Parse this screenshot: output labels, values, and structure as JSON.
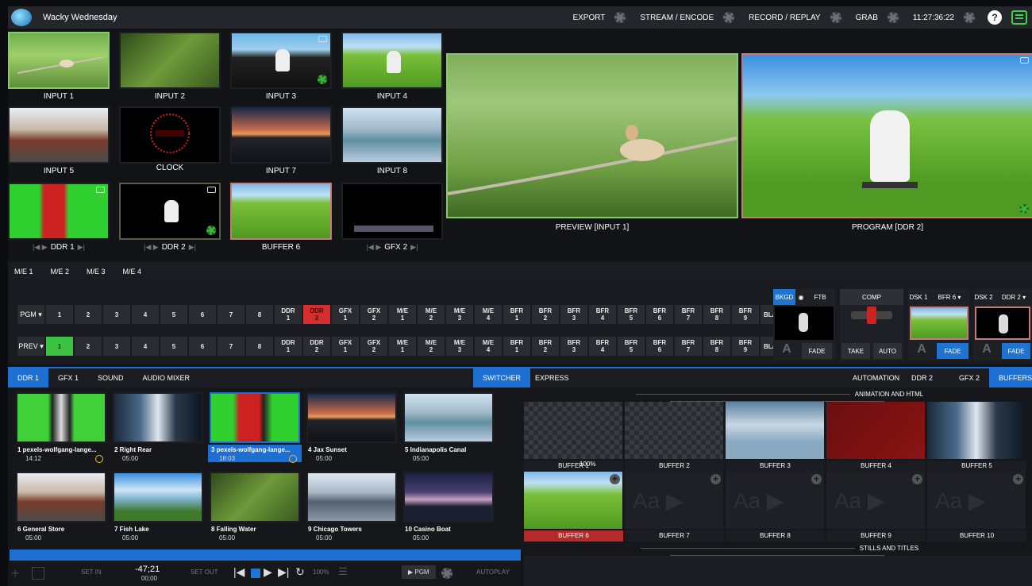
{
  "app": {
    "title": "Wacky Wednesday"
  },
  "topnav": {
    "export": "EXPORT",
    "stream": "STREAM / ENCODE",
    "record": "RECORD / REPLAY",
    "grab": "GRAB",
    "clock": "11:27:36:22",
    "help": "?"
  },
  "inputs": [
    {
      "label": "INPUT 1"
    },
    {
      "label": "INPUT 2"
    },
    {
      "label": "INPUT 3"
    },
    {
      "label": "INPUT 4"
    },
    {
      "label": "INPUT 5"
    },
    {
      "label": "CLOCK"
    },
    {
      "label": "INPUT 7"
    },
    {
      "label": "INPUT 8"
    },
    {
      "label": "DDR 1"
    },
    {
      "label": "DDR 2"
    },
    {
      "label": "BUFFER 6"
    },
    {
      "label": "GFX 2"
    }
  ],
  "monitors": {
    "preview": "PREVIEW [INPUT 1]",
    "program": "PROGRAM [DDR 2]"
  },
  "me_tabs": [
    "M/E 1",
    "M/E 2",
    "M/E 3",
    "M/E 4"
  ],
  "switcher": {
    "pgm_label": "PGM ▾",
    "prev_label": "PREV ▾",
    "buttons": [
      "1",
      "2",
      "3",
      "4",
      "5",
      "6",
      "7",
      "8",
      "DDR 1",
      "DDR 2",
      "GFX 1",
      "GFX 2",
      "M/E 1",
      "M/E 2",
      "M/E 3",
      "M/E 4",
      "BFR 1",
      "BFR 2",
      "BFR 3",
      "BFR 4",
      "BFR 5",
      "BFR 6",
      "BFR 7",
      "BFR 8",
      "BFR 9",
      "BLACK"
    ],
    "pgm_active": "DDR 2",
    "prev_active": "1",
    "colors": {
      "program": "#d42e2e",
      "preview": "#3cc243",
      "accent": "#1d74d1"
    }
  },
  "transition": {
    "bkgd": "BKGD",
    "ftb": "FTB",
    "fade": "Fade",
    "comp": "COMP",
    "take": "TAKE",
    "auto": "AUTO",
    "dsk1": "DSK 1",
    "dsk1_src": "BFR 6 ▾",
    "dsk1_fade": "Fade",
    "dsk2": "DSK 2",
    "dsk2_src": "DDR 2 ▾",
    "dsk2_fade": "Fade",
    "tbar_letter": "A"
  },
  "lower_tabs_left": [
    "DDR 1",
    "GFX 1",
    "SOUND",
    "AUDIO MIXER"
  ],
  "switcher_tab": "SWITCHER",
  "lower_tabs_right": [
    "EXPRESS",
    "AUTOMATION",
    "DDR 2",
    "GFX 2",
    "BUFFERS"
  ],
  "clips": [
    {
      "name": "1 pexels-wolfgang-lange...",
      "dur": "14:12"
    },
    {
      "name": "2 Right Rear",
      "dur": "05:00"
    },
    {
      "name": "3 pexels-wolfgang-lange...",
      "dur": "18:03"
    },
    {
      "name": "4 Jax Sunset",
      "dur": "05:00"
    },
    {
      "name": "5 Indianapolis Canal",
      "dur": "05:00"
    },
    {
      "name": "6 General Store",
      "dur": "05:00"
    },
    {
      "name": "7 Fish Lake",
      "dur": "05:00"
    },
    {
      "name": "8 Falling Water",
      "dur": "05:00"
    },
    {
      "name": "9 Chicago Towers",
      "dur": "05:00"
    },
    {
      "name": "10 Casino Boat",
      "dur": "05:00"
    }
  ],
  "transport": {
    "set_in": "SET IN",
    "time": "-47;21",
    "time2": "00;00",
    "set_out": "SET OUT",
    "speed": "100%",
    "pgm": "▶ PGM",
    "autoplay": "Autoplay"
  },
  "buffers": {
    "section1": "ANIMATION AND HTML",
    "section2": "STILLS AND TITLES",
    "items": [
      "BUFFER 1",
      "BUFFER 2",
      "BUFFER 3",
      "BUFFER 4",
      "BUFFER 5",
      "BUFFER 6",
      "BUFFER 7",
      "BUFFER 8",
      "BUFFER 9",
      "BUFFER 10"
    ],
    "buffer1_zoom": "100%",
    "buffer6_color": "#b52b2b"
  }
}
